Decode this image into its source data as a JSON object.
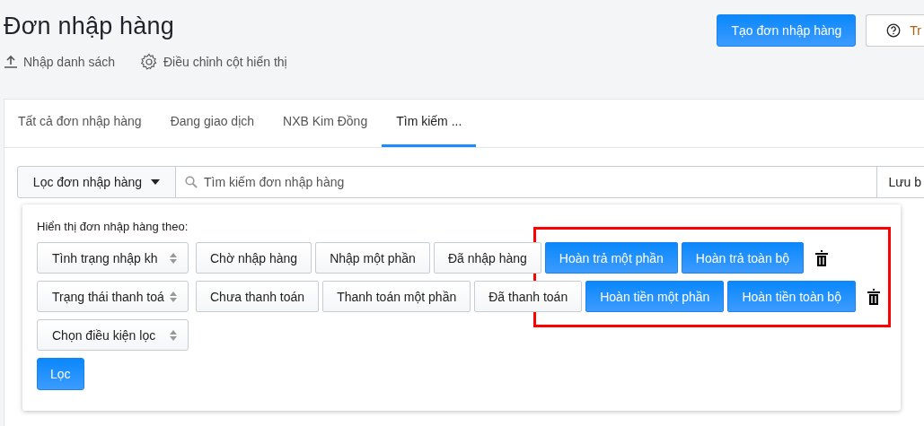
{
  "header": {
    "title": "Đơn nhập hàng",
    "actions": [
      {
        "kind": "upload",
        "label": "Nhập danh sách"
      },
      {
        "kind": "settings",
        "label": "Điều chỉnh cột hiển thị"
      }
    ],
    "buttons": [
      {
        "kind": "primary",
        "label": "Tạo đơn nhập hàng"
      },
      {
        "kind": "help",
        "label": "Tr"
      }
    ]
  },
  "tabs": [
    {
      "label": "Tất cả đơn nhập hàng",
      "selected": false
    },
    {
      "label": "Đang giao dịch",
      "selected": false
    },
    {
      "label": "NXB Kim Đồng",
      "selected": false
    },
    {
      "label": "Tìm kiếm ...",
      "selected": true
    }
  ],
  "search_bar": {
    "filter_button": "Lọc đơn nhập hàng",
    "placeholder": "Tìm kiếm đơn nhập hàng",
    "save_button": "Lưu b"
  },
  "filter_panel": {
    "heading": "Hiển thị đơn nhập hàng theo:",
    "rows": [
      {
        "field": "Tình trạng nhập kh",
        "options": [
          {
            "label": "Chờ nhập hàng",
            "selected": false
          },
          {
            "label": "Nhập một phần",
            "selected": false
          },
          {
            "label": "Đã nhập hàng",
            "selected": false
          },
          {
            "label": "Hoàn trả một phần",
            "selected": true
          },
          {
            "label": "Hoàn trả toàn bộ",
            "selected": true
          }
        ],
        "removable": true
      },
      {
        "field": "Trạng thái thanh toá",
        "options": [
          {
            "label": "Chưa thanh toán",
            "selected": false
          },
          {
            "label": "Thanh toán một phần",
            "selected": false
          },
          {
            "label": "Đã thanh toán",
            "selected": false
          },
          {
            "label": "Hoàn tiền một phần",
            "selected": true
          },
          {
            "label": "Hoàn tiền toàn bộ",
            "selected": true
          }
        ],
        "removable": true
      },
      {
        "field": "Chọn điều kiện lọc",
        "options": [],
        "removable": false
      }
    ],
    "apply_button": "Lọc",
    "highlighted": true
  }
}
